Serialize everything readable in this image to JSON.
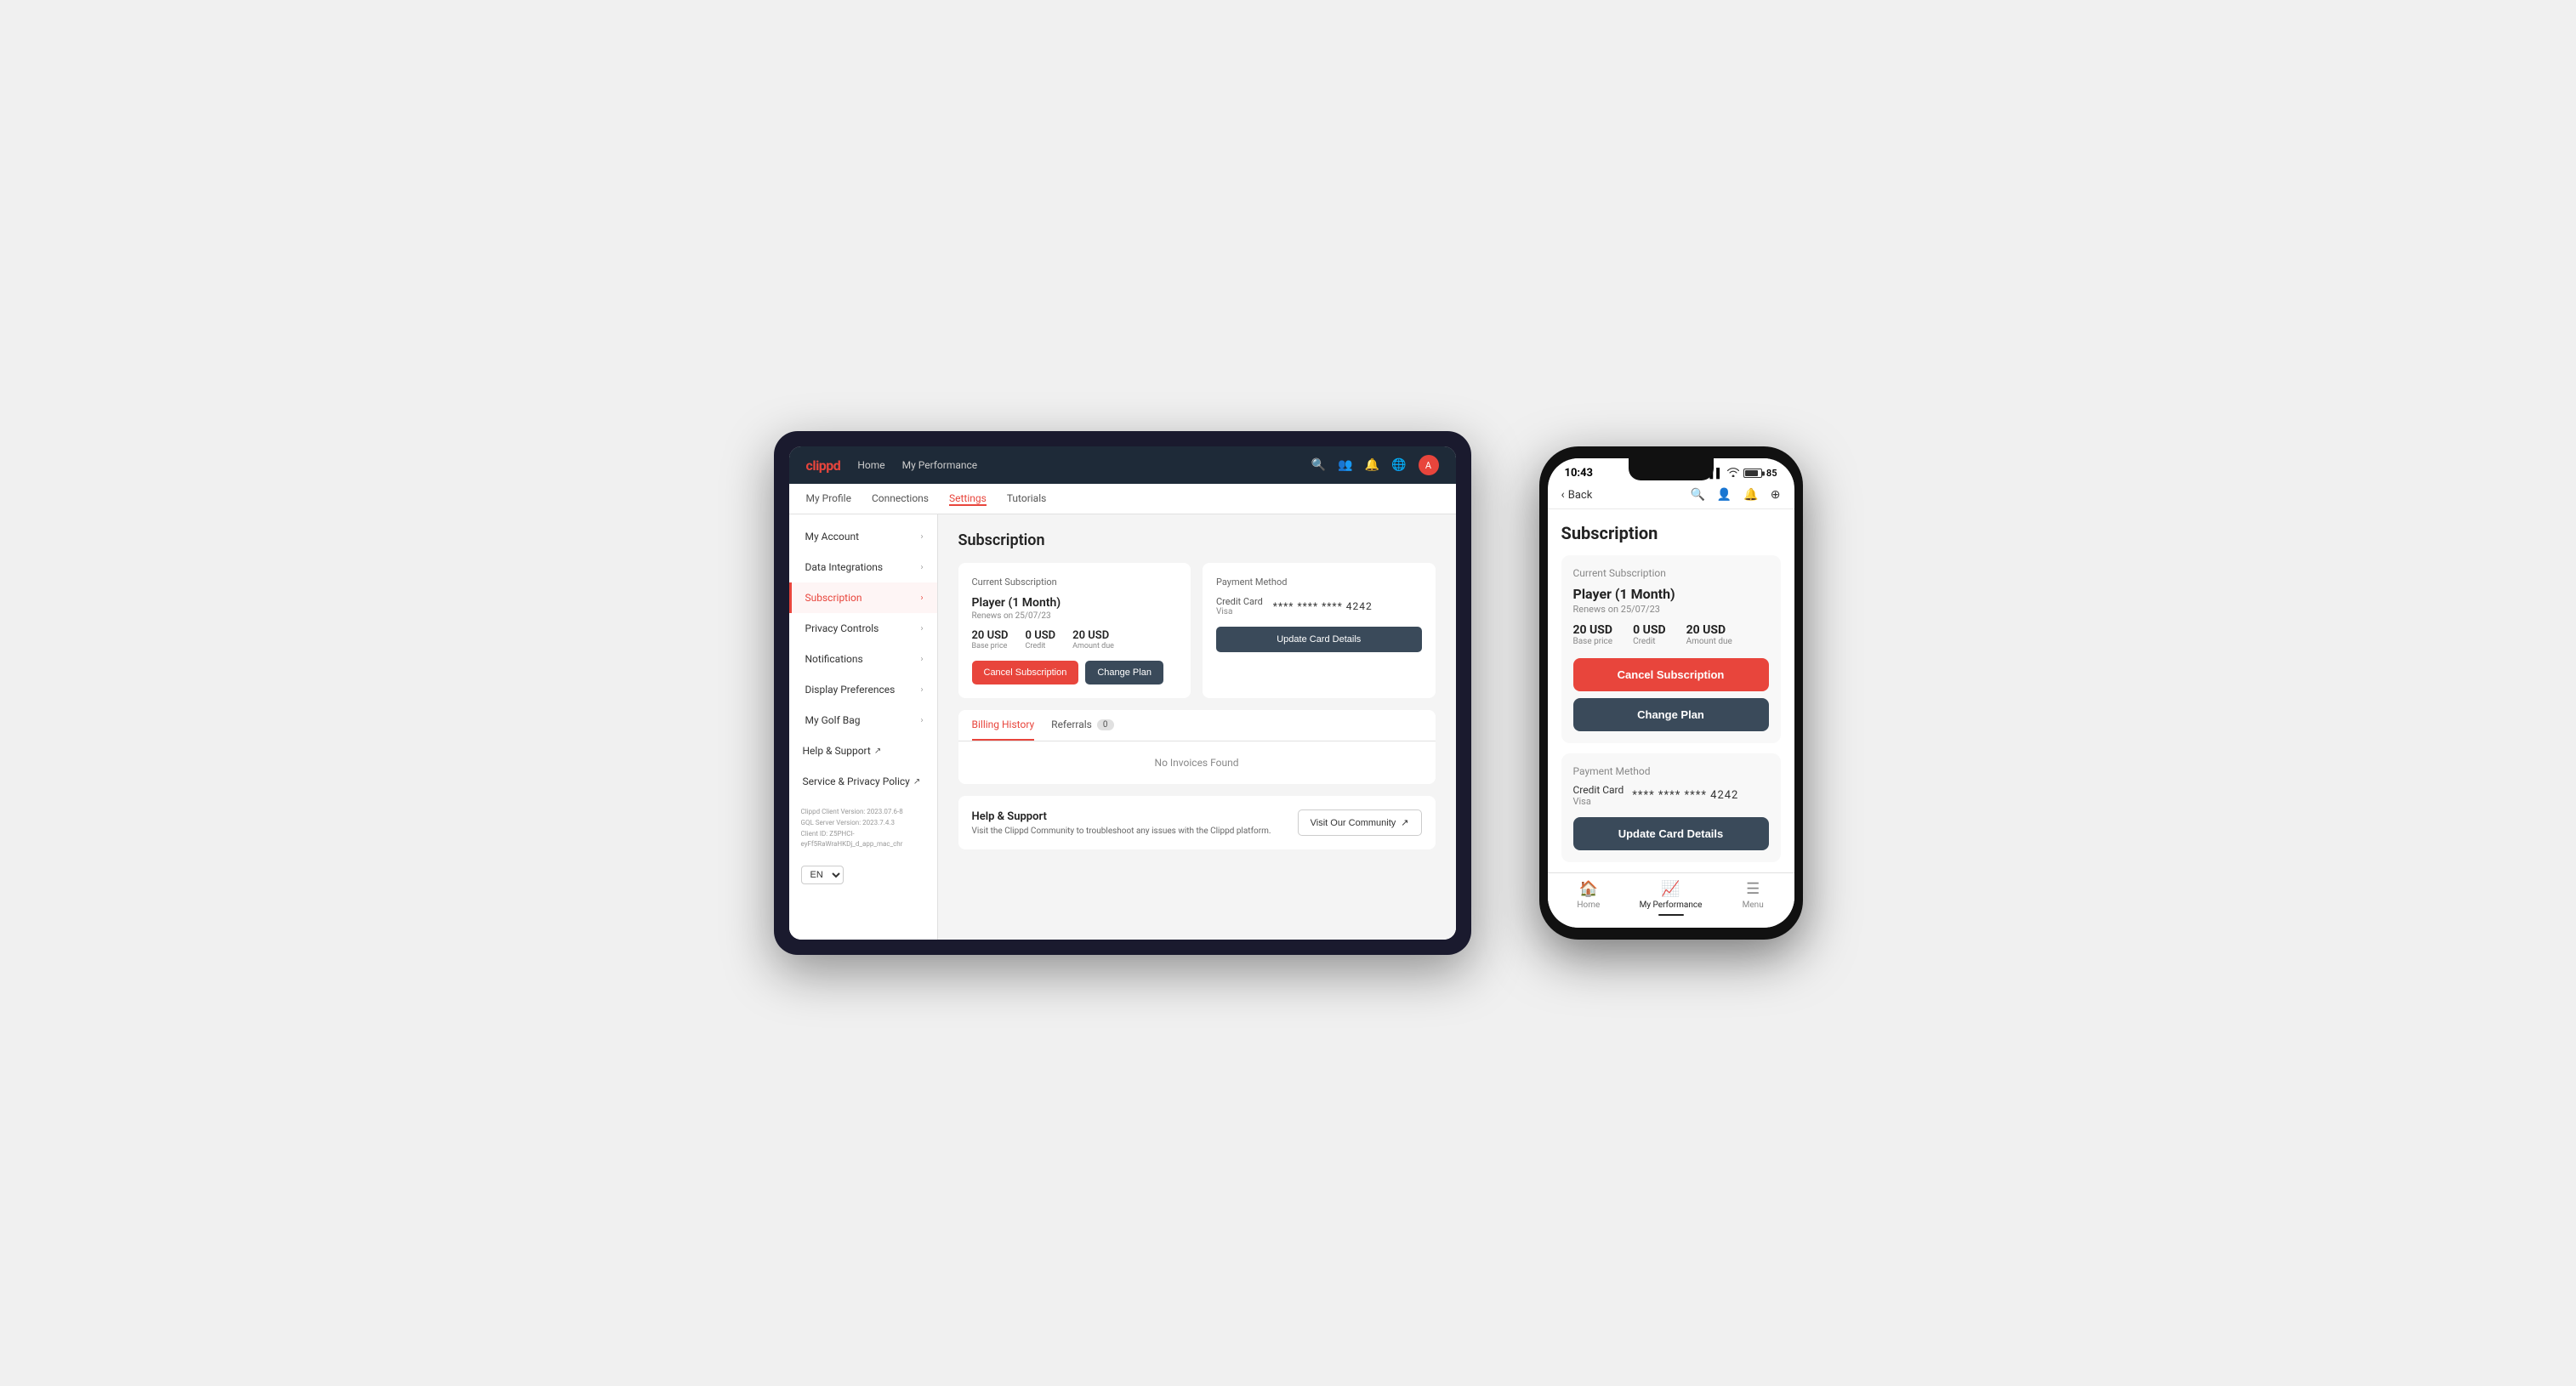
{
  "tablet": {
    "nav": {
      "logo": "clippd",
      "links": [
        "Home",
        "My Performance"
      ],
      "icons": [
        "search",
        "users",
        "bell",
        "globe",
        "user"
      ]
    },
    "subnav": {
      "items": [
        "My Profile",
        "Connections",
        "Settings",
        "Tutorials"
      ],
      "active": "Settings"
    },
    "sidebar": {
      "items": [
        {
          "label": "My Account",
          "active": false
        },
        {
          "label": "Data Integrations",
          "active": false
        },
        {
          "label": "Subscription",
          "active": true
        },
        {
          "label": "Privacy Controls",
          "active": false
        },
        {
          "label": "Notifications",
          "active": false
        },
        {
          "label": "Display Preferences",
          "active": false
        },
        {
          "label": "My Golf Bag",
          "active": false
        }
      ],
      "links": [
        {
          "label": "Help & Support",
          "external": true
        },
        {
          "label": "Service & Privacy Policy",
          "external": true
        }
      ],
      "footer": {
        "line1": "Clippd Client Version: 2023.07.6-8",
        "line2": "GQL Server Version: 2023.7.4.3",
        "line3": "Client ID: Z5PHCl-eyFf5RaWraHKDj_d_app_mac_chr"
      },
      "language": "EN"
    },
    "main": {
      "title": "Subscription",
      "current_subscription": {
        "section_label": "Current Subscription",
        "plan_name": "Player (1 Month)",
        "renews": "Renews on 25/07/23",
        "base_price": "20 USD",
        "base_price_label": "Base price",
        "credit": "0 USD",
        "credit_label": "Credit",
        "amount_due": "20 USD",
        "amount_due_label": "Amount due",
        "btn_cancel": "Cancel Subscription",
        "btn_change": "Change Plan"
      },
      "payment_method": {
        "section_label": "Payment Method",
        "cc_type": "Credit Card",
        "cc_brand": "Visa",
        "cc_number": "**** **** **** 4242",
        "btn_update": "Update Card Details"
      },
      "billing": {
        "tab_billing": "Billing History",
        "tab_referrals": "Referrals",
        "referrals_count": "0",
        "empty_message": "No Invoices Found"
      },
      "help": {
        "title": "Help & Support",
        "description": "Visit the Clippd Community to troubleshoot any issues with the Clippd platform.",
        "btn_community": "Visit Our Community"
      }
    }
  },
  "phone": {
    "status_bar": {
      "time": "10:43",
      "signal": "▌▌▌",
      "wifi": "WiFi",
      "battery": "85"
    },
    "topbar": {
      "back_label": "Back",
      "icons": [
        "search",
        "person",
        "bell",
        "plus"
      ]
    },
    "page_title": "Subscription",
    "current_subscription": {
      "section_label": "Current Subscription",
      "plan_name": "Player (1 Month)",
      "renews": "Renews on 25/07/23",
      "base_price": "20 USD",
      "base_price_label": "Base price",
      "credit": "0 USD",
      "credit_label": "Credit",
      "amount_due": "20 USD",
      "amount_due_label": "Amount due",
      "btn_cancel": "Cancel Subscription",
      "btn_change": "Change Plan"
    },
    "payment_method": {
      "section_label": "Payment Method",
      "cc_type": "Credit Card",
      "cc_brand": "Visa",
      "cc_number": "**** **** **** 4242",
      "btn_update": "Update Card Details"
    },
    "bottom_nav": {
      "items": [
        "Home",
        "My Performance",
        "Menu"
      ],
      "active": "My Performance",
      "icons": [
        "🏠",
        "📈",
        "☰"
      ]
    }
  }
}
